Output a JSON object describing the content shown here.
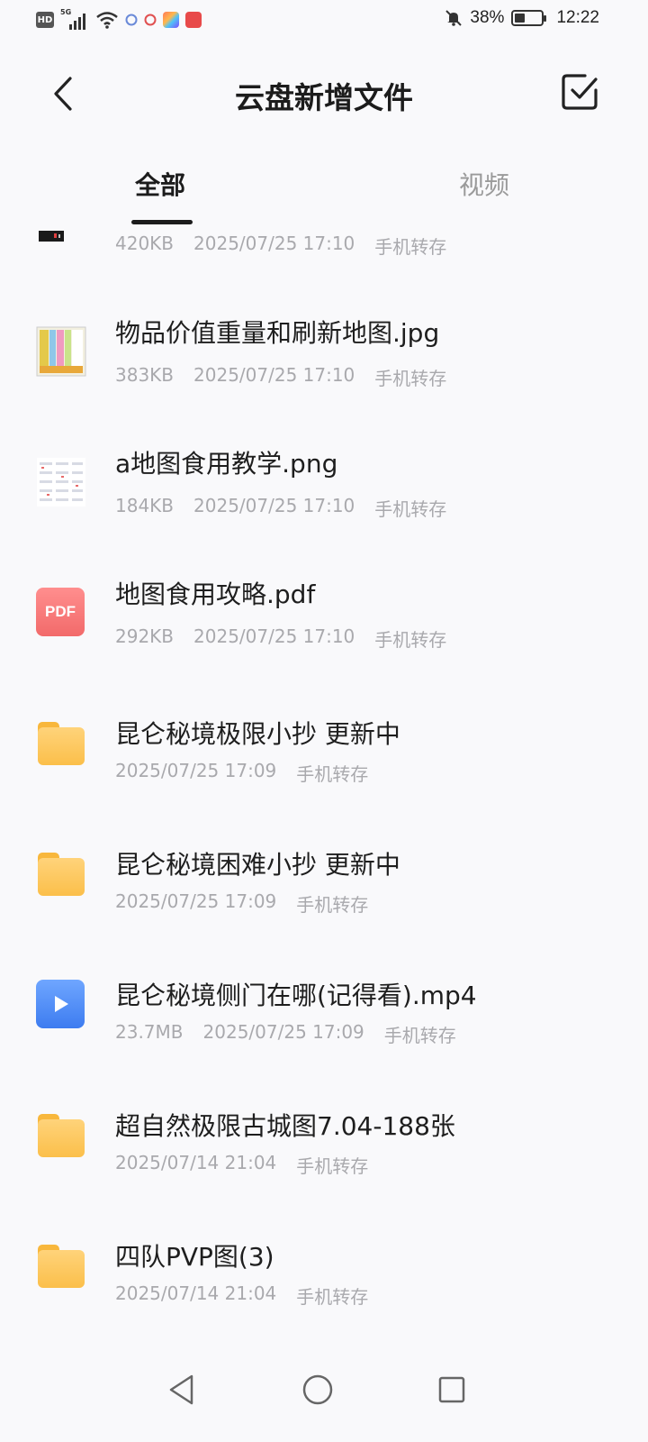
{
  "status_bar": {
    "network_badge": "HD",
    "signal_label": "5G",
    "battery": "38%",
    "battery_level": 0.38,
    "time": "12:22"
  },
  "header": {
    "title": "云盘新增文件"
  },
  "tabs": [
    {
      "label": "全部",
      "active": true
    },
    {
      "label": "视频",
      "active": false
    }
  ],
  "files": [
    {
      "name": "",
      "size": "420KB",
      "date": "2025/07/25 17:10",
      "source": "手机转存",
      "icon": "image-thumb-dark"
    },
    {
      "name": "物品价值重量和刷新地图.jpg",
      "size": "383KB",
      "date": "2025/07/25 17:10",
      "source": "手机转存",
      "icon": "image-thumb-table"
    },
    {
      "name": "a地图食用教学.png",
      "size": "184KB",
      "date": "2025/07/25 17:10",
      "source": "手机转存",
      "icon": "image-thumb-doc"
    },
    {
      "name": "地图食用攻略.pdf",
      "size": "292KB",
      "date": "2025/07/25 17:10",
      "source": "手机转存",
      "icon": "pdf-icon",
      "icon_text": "PDF"
    },
    {
      "name": "昆仑秘境极限小抄 更新中",
      "size": "",
      "date": "2025/07/25 17:09",
      "source": "手机转存",
      "icon": "folder-icon"
    },
    {
      "name": "昆仑秘境困难小抄  更新中",
      "size": "",
      "date": "2025/07/25 17:09",
      "source": "手机转存",
      "icon": "folder-icon"
    },
    {
      "name": "昆仑秘境侧门在哪(记得看).mp4",
      "size": "23.7MB",
      "date": "2025/07/25 17:09",
      "source": "手机转存",
      "icon": "video-icon"
    },
    {
      "name": "超自然极限古城图7.04-188张",
      "size": "",
      "date": "2025/07/14 21:04",
      "source": "手机转存",
      "icon": "folder-icon"
    },
    {
      "name": "四队PVP图(3)",
      "size": "",
      "date": "2025/07/14 21:04",
      "source": "手机转存",
      "icon": "folder-icon"
    }
  ],
  "colors": {
    "background": "#f9f9fb",
    "folder": "#fbbf4a",
    "pdf": "#f26a6a",
    "video": "#3d7cf0",
    "meta_text": "#a9a9ad"
  }
}
